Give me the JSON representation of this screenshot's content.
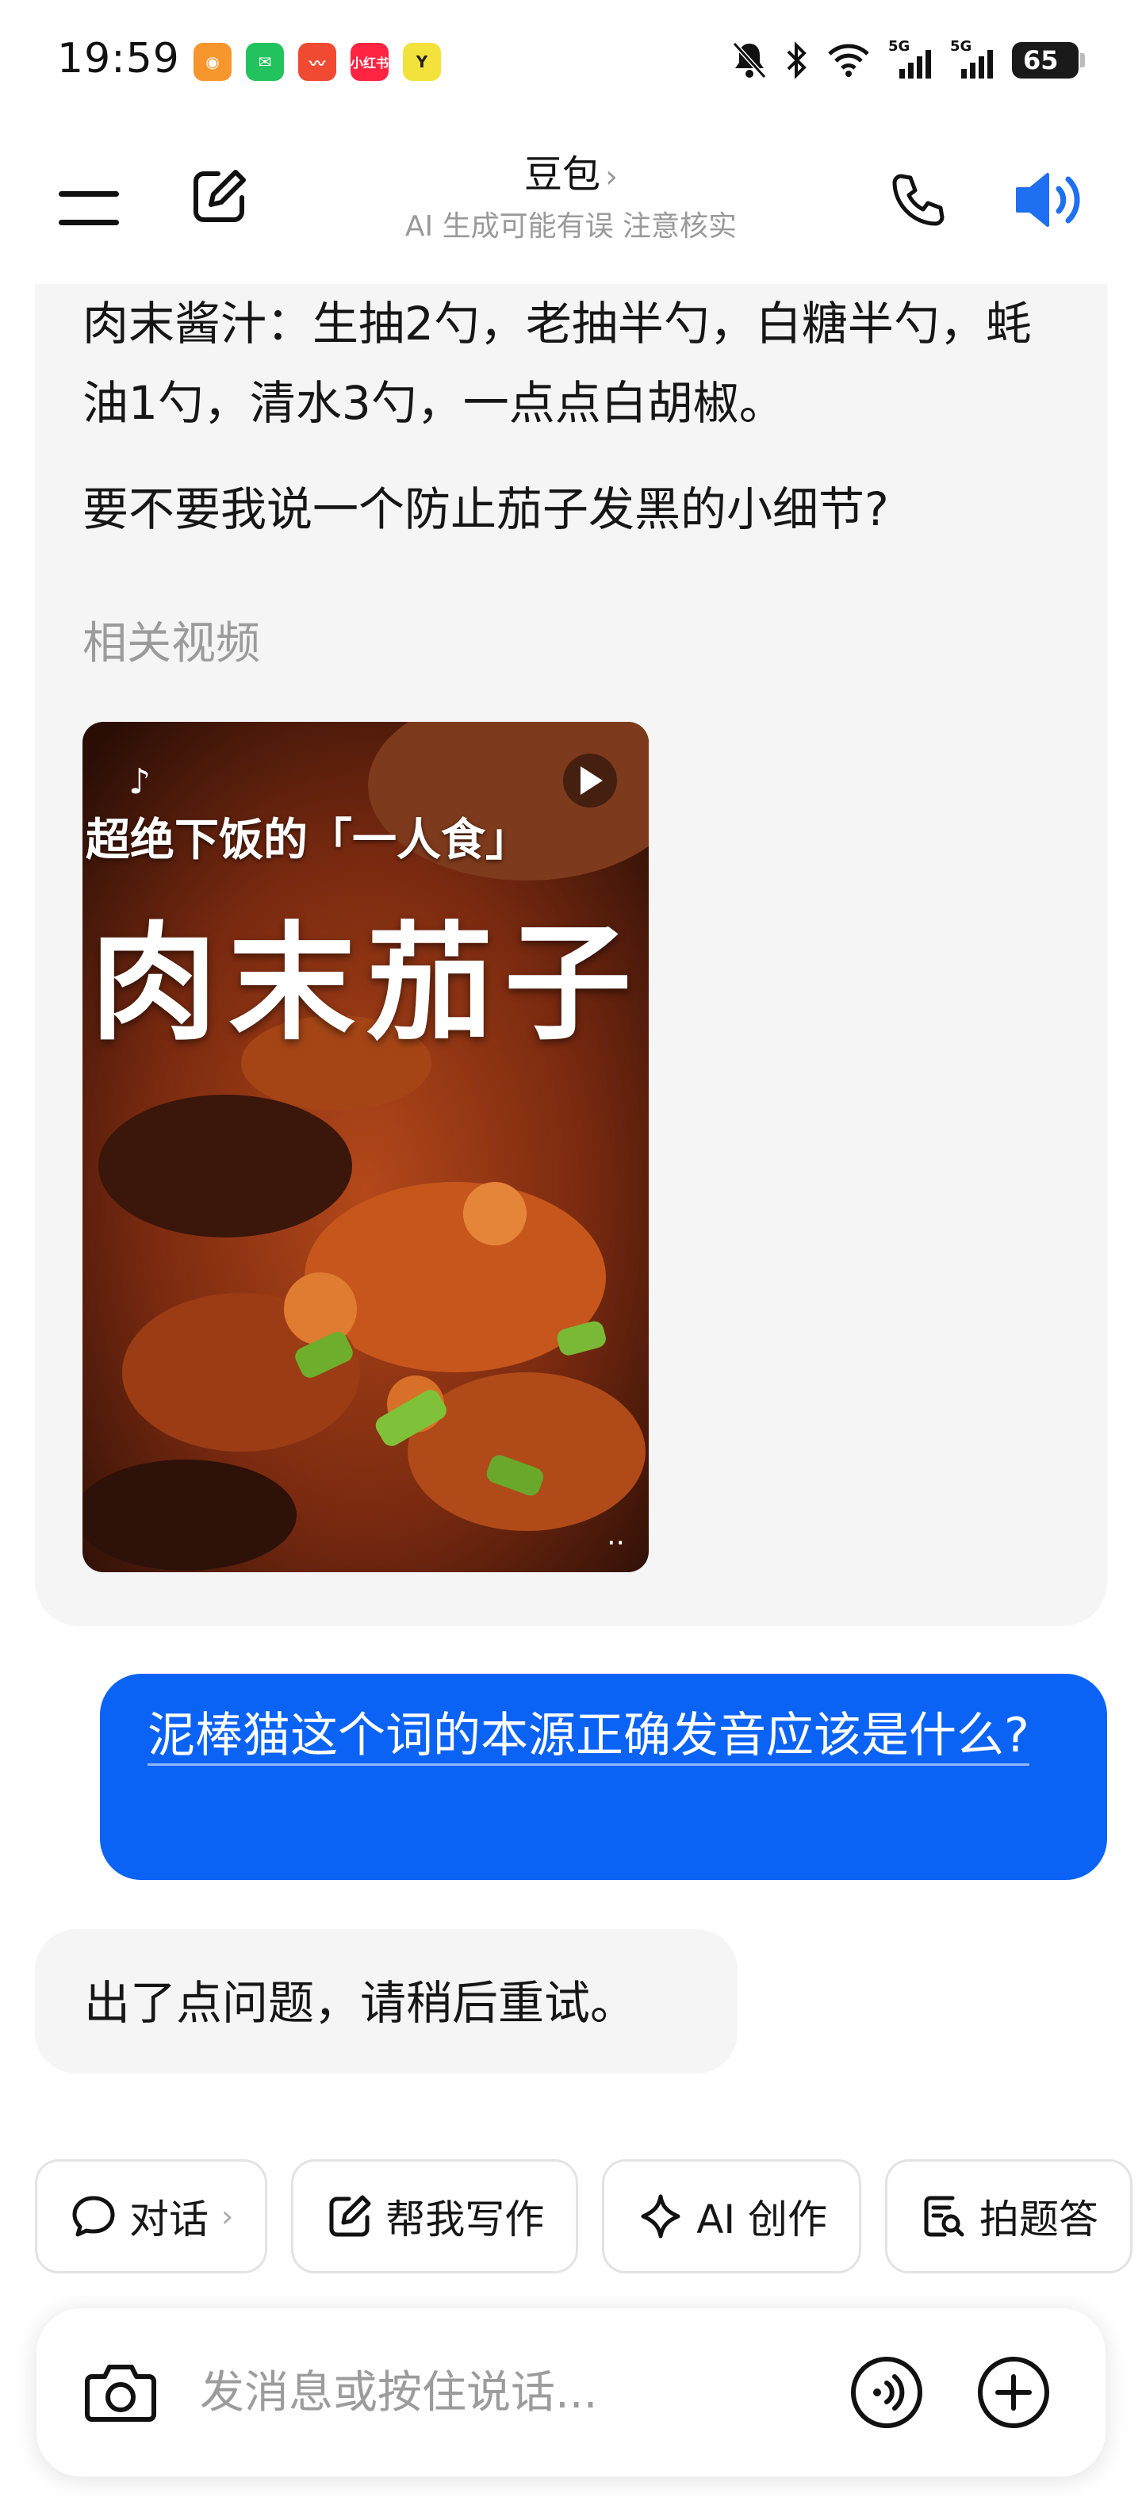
{
  "status_bar": {
    "time": "19:59",
    "apps": [
      {
        "name": "app-icon-orange",
        "color": "#f6962c",
        "glyph": "◉"
      },
      {
        "name": "wechat-icon",
        "color": "#22c35e",
        "glyph": "✉"
      },
      {
        "name": "trend-app-icon",
        "color": "#f04a32",
        "glyph": "⟋"
      },
      {
        "name": "xiaohongshu-icon",
        "color": "#ff2442",
        "glyph": "小"
      },
      {
        "name": "app-icon-yellow",
        "color": "#f3e23b",
        "glyph": "Y"
      }
    ],
    "signal1": "5G",
    "signal2": "5G",
    "battery": "65"
  },
  "header": {
    "title": "豆包",
    "chevron": "›",
    "subtitle": "AI 生成可能有误 注意核实"
  },
  "bot_message": {
    "line1": "肉末酱汁：生抽2勺，老抽半勺，白糖半勺，蚝油1勺，清水3勺，一点点白胡椒。",
    "question": "要不要我说一个防止茄子发黑的小细节?",
    "related_label": "相关视频",
    "video": {
      "title_small": "超绝下饭的「一人食」",
      "title_big": "肉末茄子",
      "more": "··"
    }
  },
  "user_message": "泥棒猫这个词的本源正确发音应该是什么?",
  "error_message": "出了点问题，请稍后重试。",
  "quick_actions": [
    {
      "label": "对话",
      "icon": "chat-bubble-icon",
      "chevron": "›"
    },
    {
      "label": "帮我写作",
      "icon": "write-icon"
    },
    {
      "label": "AI 创作",
      "icon": "sparkle-icon"
    },
    {
      "label": "拍题答",
      "icon": "photo-question-icon"
    }
  ],
  "input": {
    "placeholder": "发消息或按住说话..."
  },
  "colors": {
    "accent": "#0b63f6",
    "bubble_gray": "#f5f5f5"
  }
}
